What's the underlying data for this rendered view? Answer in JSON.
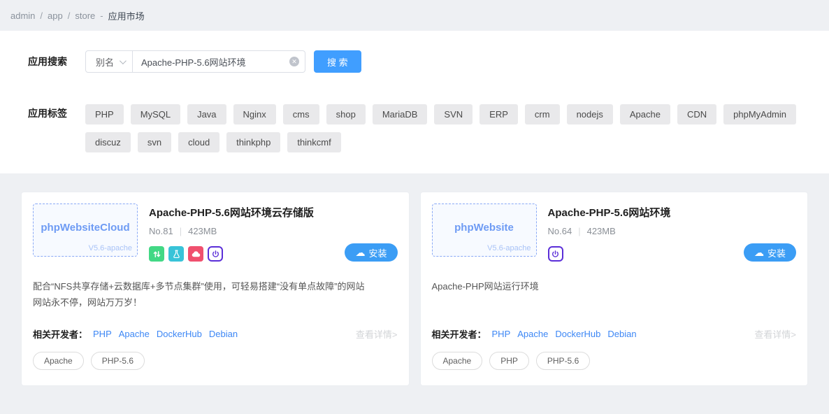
{
  "colors": {
    "accent_blue": "#409eff",
    "link_blue": "#3d87f5",
    "page_bg": "#eef0f3",
    "badge_green": "#42d885",
    "badge_teal": "#38c3d8",
    "badge_red": "#f0506e",
    "badge_purple": "#5b2fd8"
  },
  "icons": {
    "install_cloud": "☁",
    "clear": "✕"
  },
  "breadcrumb": {
    "items": [
      "admin",
      "app",
      "store"
    ],
    "separator": "/",
    "dash": "-",
    "current": "应用市场"
  },
  "search": {
    "label": "应用搜索",
    "select_value": "别名",
    "input_value": "Apache-PHP-5.6网站环境",
    "button_label": "搜 索"
  },
  "tag_filter": {
    "label": "应用标签",
    "row1": [
      "PHP",
      "MySQL",
      "Java",
      "Nginx",
      "cms",
      "shop",
      "MariaDB",
      "SVN",
      "ERP",
      "crm",
      "nodejs",
      "Apache",
      "CDN",
      "phpMyAdmin"
    ],
    "row2": [
      "discuz",
      "svn",
      "cloud",
      "thinkphp",
      "thinkcmf"
    ]
  },
  "cards": [
    {
      "logo_title": "phpWebsiteCloud",
      "logo_version": "V5.6-apache",
      "title": "Apache-PHP-5.6网站环境云存储版",
      "rank": "No.81",
      "divider": "|",
      "size": "423MB",
      "install_label": "安装",
      "description": "配合“NFS共享存储+云数据库+多节点集群”使用，可轻易搭建“没有单点故障”的网站\n网站永不停，网站万万岁！",
      "developers_label": "相关开发者：",
      "developers": [
        "PHP",
        "Apache",
        "DockerHub",
        "Debian"
      ],
      "details_label": "查看详情>",
      "tags": [
        "Apache",
        "PHP-5.6"
      ]
    },
    {
      "logo_title": "phpWebsite",
      "logo_version": "V5.6-apache",
      "title": "Apache-PHP-5.6网站环境",
      "rank": "No.64",
      "divider": "|",
      "size": "423MB",
      "install_label": "安装",
      "description": "Apache-PHP网站运行环境",
      "developers_label": "相关开发者：",
      "developers": [
        "PHP",
        "Apache",
        "DockerHub",
        "Debian"
      ],
      "details_label": "查看详情>",
      "tags": [
        "Apache",
        "PHP",
        "PHP-5.6"
      ]
    }
  ]
}
